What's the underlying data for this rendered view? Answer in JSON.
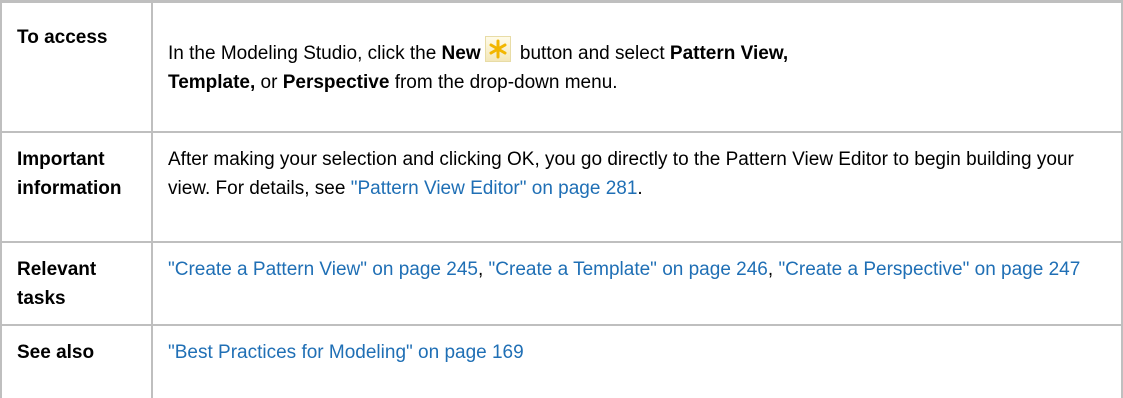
{
  "rows": {
    "access": {
      "label": "To access",
      "text_1": "In the Modeling Studio, click the ",
      "bold_new": "New",
      "text_2": " button and select ",
      "bold_pattern_view": "Pattern View,",
      "text_3": " ",
      "bold_template": "Template,",
      "text_4": " or ",
      "bold_perspective": "Perspective",
      "text_5": " from the drop-down menu.",
      "icon": "new-star-icon"
    },
    "important": {
      "label": "Important information",
      "text_1": "After making your selection and clicking OK, you go directly to the Pattern View Editor to begin building your view. For details, see ",
      "link": "\"Pattern View Editor\" on page 281",
      "text_2": "."
    },
    "tasks": {
      "label": "Relevant tasks",
      "link_1": "\"Create a Pattern View\" on page 245",
      "sep_1": ", ",
      "link_2": "\"Create a Template\" on page 246",
      "sep_2": ", ",
      "link_3": "\"Create a Perspective\" on page 247"
    },
    "see_also": {
      "label": "See also",
      "link": "\"Best Practices for Modeling\" on page 169"
    }
  },
  "colors": {
    "link": "#1f6fb5",
    "border": "#bfbfbf",
    "icon_star": "#f2b600"
  }
}
